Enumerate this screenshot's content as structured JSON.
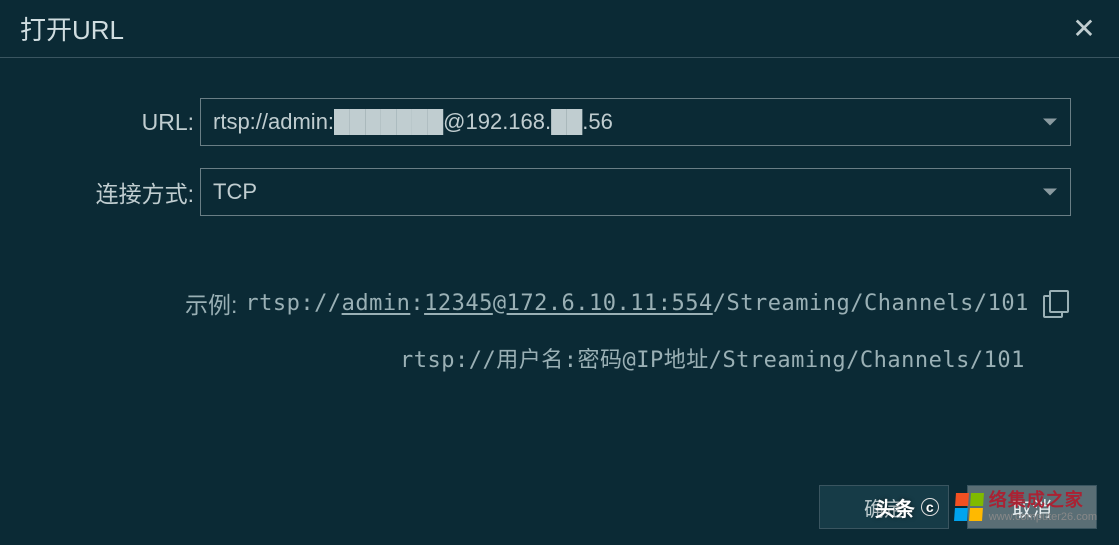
{
  "dialog": {
    "title": "打开URL",
    "close_glyph": "✕"
  },
  "form": {
    "url_label": "URL:",
    "url_value": "rtsp://admin:███████@192.168.██.56",
    "conn_label": "连接方式:",
    "conn_value": "TCP"
  },
  "example": {
    "label": "示例:",
    "prefix": "rtsp://",
    "user": "admin",
    "colon": ":",
    "pass": "12345",
    "at": "@",
    "host": "172.6.10.11:554",
    "tail": "/Streaming/Channels/101",
    "line2": "rtsp://用户名:密码@IP地址/Streaming/Channels/101"
  },
  "buttons": {
    "ok": "确定",
    "cancel": "取消"
  },
  "watermarks": {
    "toutiao": "头条",
    "site_cn": "络集成之家",
    "site_en": "www.computer26.com"
  }
}
